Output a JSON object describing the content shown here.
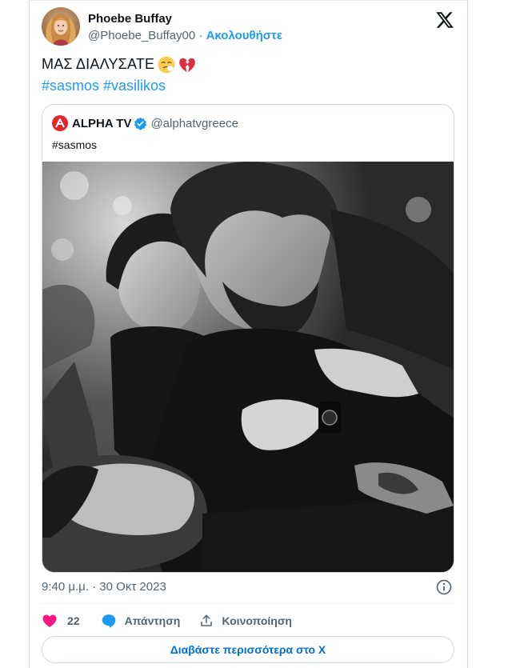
{
  "author": {
    "display_name": "Phoebe Buffay",
    "handle": "@Phoebe_Buffay00",
    "separator": " · ",
    "follow_label": "Ακολουθήστε"
  },
  "tweet": {
    "text": "ΜΑΣ ΔΙΑΛΥΣΑΤΕ",
    "emojis": [
      "sneezing-face-emoji",
      "broken-heart-emoji"
    ],
    "hashtags": "#sasmos #vasilikos"
  },
  "quote": {
    "name": "ALPHA TV",
    "verified": true,
    "handle": "@alphatvgreece",
    "text": "#sasmos",
    "photo": "black-and-white-drama-scene"
  },
  "timestamp": "9:40 μ.μ. · 30 Οκτ 2023",
  "actions": {
    "like_count": "22",
    "reply_label": "Απάντηση",
    "share_label": "Κοινοποίηση"
  },
  "read_more_label": "Διαβάστε περισσότερα στο X",
  "colors": {
    "accent": "#1d9bf0",
    "like": "#f91880",
    "reply": "#1d9bf0",
    "secondary_text": "#536471",
    "border": "#cfd9de"
  }
}
